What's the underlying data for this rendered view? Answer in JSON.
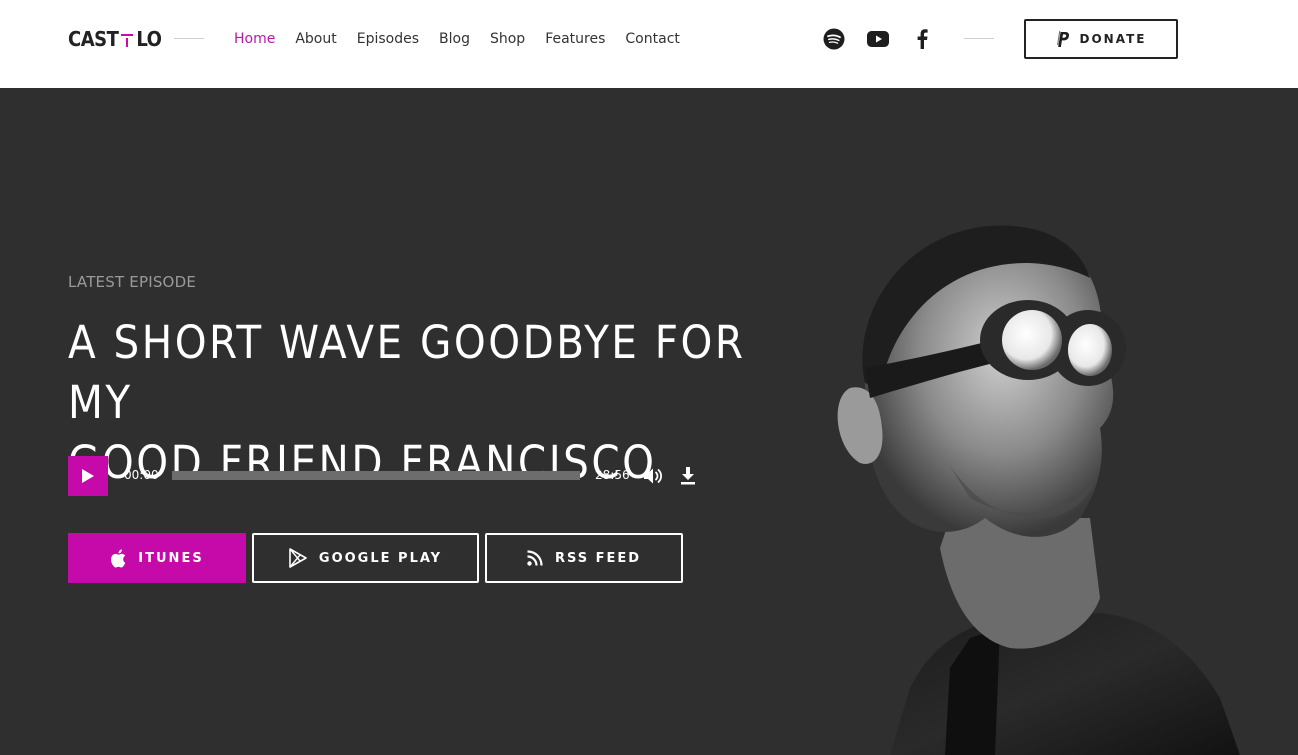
{
  "brand": {
    "logo_left": "CAST",
    "logo_right": "LO",
    "accent_color": "#c60aa9"
  },
  "nav": {
    "items": [
      {
        "label": "Home",
        "active": true
      },
      {
        "label": "About",
        "active": false
      },
      {
        "label": "Episodes",
        "active": false
      },
      {
        "label": "Blog",
        "active": false
      },
      {
        "label": "Shop",
        "active": false
      },
      {
        "label": "Features",
        "active": false
      },
      {
        "label": "Contact",
        "active": false
      }
    ]
  },
  "social": [
    "spotify-icon",
    "youtube-icon",
    "facebook-icon"
  ],
  "donate": {
    "label": "DONATE",
    "icon": "paypal-icon"
  },
  "hero": {
    "eyebrow": "LATEST EPISODE",
    "title_line1": "A SHORT WAVE GOODBYE FOR MY",
    "title_line2": "GOOD FRIEND FRANCISCO"
  },
  "player": {
    "current_time": "00:00",
    "duration": "28:56",
    "progress": 0
  },
  "subscribe": {
    "itunes": "ITUNES",
    "google_play": "GOOGLE PLAY",
    "rss": "RSS FEED"
  }
}
